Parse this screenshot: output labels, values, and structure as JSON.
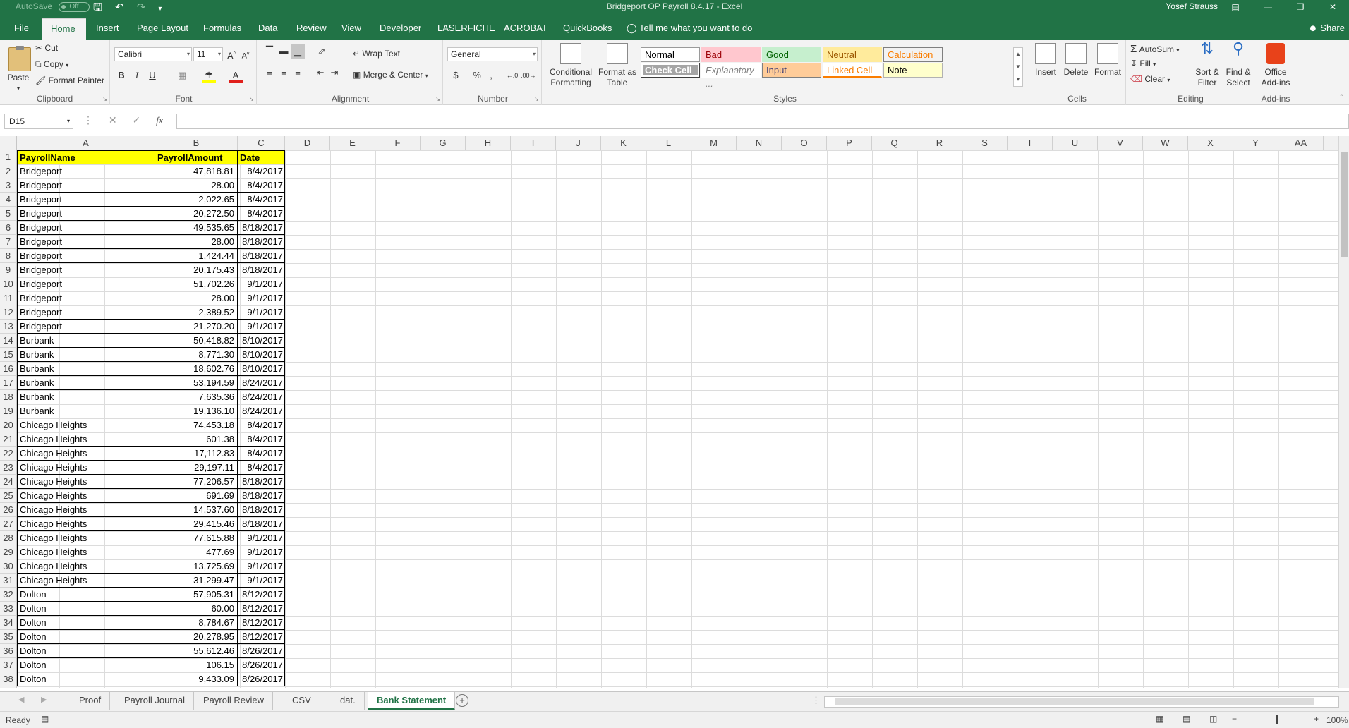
{
  "titlebar": {
    "autosave_label": "AutoSave",
    "autosave_state": "Off",
    "title": "Bridgeport OP Payroll 8.4.17  -  Excel",
    "user": "Yosef Strauss"
  },
  "tabs": [
    "File",
    "Home",
    "Insert",
    "Page Layout",
    "Formulas",
    "Data",
    "Review",
    "View",
    "Developer",
    "LASERFICHE",
    "ACROBAT",
    "QuickBooks"
  ],
  "tell_me": "Tell me what you want to do",
  "share": "Share",
  "ribbon": {
    "clipboard": {
      "paste": "Paste",
      "cut": "Cut",
      "copy": "Copy",
      "format_painter": "Format Painter",
      "label": "Clipboard"
    },
    "font": {
      "name": "Calibri",
      "size": "11",
      "label": "Font",
      "bold": "B",
      "italic": "I",
      "underline": "U"
    },
    "alignment": {
      "wrap": "Wrap Text",
      "merge": "Merge & Center",
      "label": "Alignment"
    },
    "number": {
      "format": "General",
      "label": "Number",
      "currency": "$",
      "percent": "%",
      "comma": ","
    },
    "styles": {
      "conditional": "Conditional Formatting",
      "format_table": "Format as Table",
      "label": "Styles",
      "cells": [
        {
          "name": "Normal",
          "bg": "#ffffff",
          "fg": "#000000",
          "border": "#9a9a9a"
        },
        {
          "name": "Bad",
          "bg": "#ffc7ce",
          "fg": "#9c0006",
          "border": "#ffc7ce"
        },
        {
          "name": "Good",
          "bg": "#c6efce",
          "fg": "#006100",
          "border": "#c6efce"
        },
        {
          "name": "Neutral",
          "bg": "#ffeb9c",
          "fg": "#9c5700",
          "border": "#ffeb9c"
        },
        {
          "name": "Calculation",
          "bg": "#f2f2f2",
          "fg": "#fa7d00",
          "border": "#7f7f7f"
        },
        {
          "name": "Check Cell",
          "bg": "#a5a5a5",
          "fg": "#ffffff",
          "border": "#3f3f3f"
        },
        {
          "name": "Explanatory ...",
          "bg": "#ffffff",
          "fg": "#7f7f7f",
          "border": "#ffffff"
        },
        {
          "name": "Input",
          "bg": "#ffcc99",
          "fg": "#3f3f76",
          "border": "#7f7f7f"
        },
        {
          "name": "Linked Cell",
          "bg": "#ffffff",
          "fg": "#fa7d00",
          "border": "#ffffff"
        },
        {
          "name": "Note",
          "bg": "#ffffcc",
          "fg": "#000000",
          "border": "#b2b2b2"
        }
      ]
    },
    "cells": {
      "insert": "Insert",
      "delete": "Delete",
      "format": "Format",
      "label": "Cells"
    },
    "editing": {
      "autosum": "AutoSum",
      "fill": "Fill",
      "clear": "Clear",
      "sort": "Sort & Filter",
      "find": "Find & Select",
      "label": "Editing"
    },
    "addins": {
      "office": "Office Add-ins",
      "label": "Add-ins"
    }
  },
  "formula_bar": {
    "name_box": "D15",
    "fx": "fx",
    "value": ""
  },
  "columns": [
    "A",
    "B",
    "C",
    "D",
    "E",
    "F",
    "G",
    "H",
    "I",
    "J",
    "K",
    "L",
    "M",
    "N",
    "O",
    "P",
    "Q",
    "R",
    "S",
    "T",
    "U",
    "V",
    "W",
    "X",
    "Y",
    "AA"
  ],
  "header_row": [
    "PayrollName",
    "PayrollAmount",
    "Date"
  ],
  "rows": [
    [
      "Bridgeport",
      "47,818.81",
      "8/4/2017"
    ],
    [
      "Bridgeport",
      "28.00",
      "8/4/2017"
    ],
    [
      "Bridgeport",
      "2,022.65",
      "8/4/2017"
    ],
    [
      "Bridgeport",
      "20,272.50",
      "8/4/2017"
    ],
    [
      "Bridgeport",
      "49,535.65",
      "8/18/2017"
    ],
    [
      "Bridgeport",
      "28.00",
      "8/18/2017"
    ],
    [
      "Bridgeport",
      "1,424.44",
      "8/18/2017"
    ],
    [
      "Bridgeport",
      "20,175.43",
      "8/18/2017"
    ],
    [
      "Bridgeport",
      "51,702.26",
      "9/1/2017"
    ],
    [
      "Bridgeport",
      "28.00",
      "9/1/2017"
    ],
    [
      "Bridgeport",
      "2,389.52",
      "9/1/2017"
    ],
    [
      "Bridgeport",
      "21,270.20",
      "9/1/2017"
    ],
    [
      "Burbank",
      "50,418.82",
      "8/10/2017"
    ],
    [
      "Burbank",
      "8,771.30",
      "8/10/2017"
    ],
    [
      "Burbank",
      "18,602.76",
      "8/10/2017"
    ],
    [
      "Burbank",
      "53,194.59",
      "8/24/2017"
    ],
    [
      "Burbank",
      "7,635.36",
      "8/24/2017"
    ],
    [
      "Burbank",
      "19,136.10",
      "8/24/2017"
    ],
    [
      "Chicago Heights",
      "74,453.18",
      "8/4/2017"
    ],
    [
      "Chicago Heights",
      "601.38",
      "8/4/2017"
    ],
    [
      "Chicago Heights",
      "17,112.83",
      "8/4/2017"
    ],
    [
      "Chicago Heights",
      "29,197.11",
      "8/4/2017"
    ],
    [
      "Chicago Heights",
      "77,206.57",
      "8/18/2017"
    ],
    [
      "Chicago Heights",
      "691.69",
      "8/18/2017"
    ],
    [
      "Chicago Heights",
      "14,537.60",
      "8/18/2017"
    ],
    [
      "Chicago Heights",
      "29,415.46",
      "8/18/2017"
    ],
    [
      "Chicago Heights",
      "77,615.88",
      "9/1/2017"
    ],
    [
      "Chicago Heights",
      "477.69",
      "9/1/2017"
    ],
    [
      "Chicago Heights",
      "13,725.69",
      "9/1/2017"
    ],
    [
      "Chicago Heights",
      "31,299.47",
      "9/1/2017"
    ],
    [
      "Dolton",
      "57,905.31",
      "8/12/2017"
    ],
    [
      "Dolton",
      "60.00",
      "8/12/2017"
    ],
    [
      "Dolton",
      "8,784.67",
      "8/12/2017"
    ],
    [
      "Dolton",
      "20,278.95",
      "8/12/2017"
    ],
    [
      "Dolton",
      "55,612.46",
      "8/26/2017"
    ],
    [
      "Dolton",
      "106.15",
      "8/26/2017"
    ],
    [
      "Dolton",
      "9,433.09",
      "8/26/2017"
    ]
  ],
  "sheet_tabs": [
    "Proof",
    "Payroll Journal",
    "Payroll Review",
    "CSV",
    "dat.",
    "Bank Statement"
  ],
  "active_sheet": "Bank Statement",
  "status": {
    "ready": "Ready",
    "zoom": "100%"
  }
}
